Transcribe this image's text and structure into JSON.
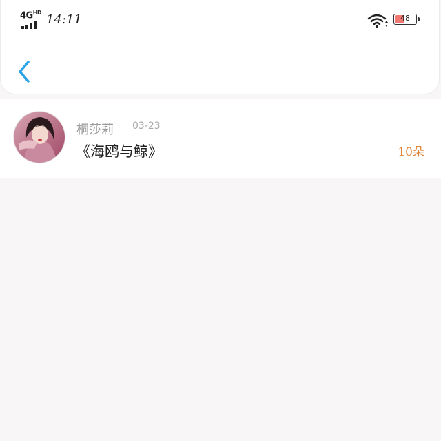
{
  "status_bar": {
    "network": "4G",
    "network_suffix": "HD",
    "time": "14:11",
    "battery_level": "48",
    "battery_color": "#f07870"
  },
  "nav": {
    "back_icon": "chevron-left-icon",
    "accent": "#2aa3e8"
  },
  "list": [
    {
      "author": "桐莎莉",
      "date": "03-23",
      "title": "《海鸥与鲸》",
      "count": "10朵",
      "count_color": "#e0843a"
    }
  ]
}
